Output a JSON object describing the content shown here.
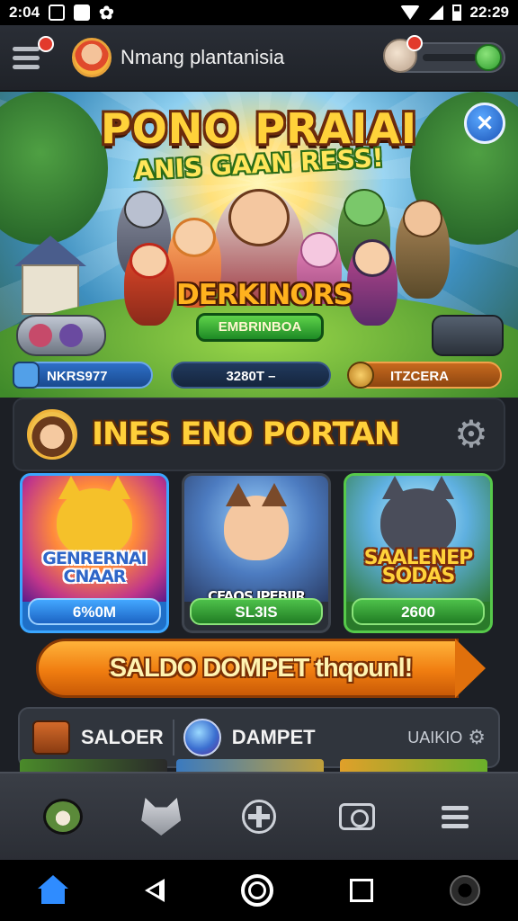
{
  "status_bar": {
    "time_left": "2:04",
    "time_right": "22:29"
  },
  "header": {
    "user_name": "Nmang plantanisia"
  },
  "banner": {
    "title": "PONO PRAIAI",
    "subtitle": "ANIS GAAN RESS!",
    "logo_text": "DERKINORS",
    "logo_plate": "EMBRINBOA",
    "stats": [
      "NKRS977",
      "3280T –",
      "ITZCERA"
    ]
  },
  "section": {
    "title": "INES ENO PORTAN"
  },
  "cards": [
    {
      "art_title": "GENRERNAI CNAAR",
      "price": "6%0M"
    },
    {
      "art_title": "CFAOS IPEBIIR",
      "price": "SL3IS"
    },
    {
      "art_title": "SAALENEP SODAS",
      "price": "2600"
    }
  ],
  "cta": {
    "label": "SALDO DOMPET thqounl!"
  },
  "wallet": {
    "left_label": "SALOER",
    "right_label": "DAMPET",
    "extra": "UAIKIO"
  },
  "colors": {
    "accent_orange": "#f07d10",
    "accent_yellow": "#ffcf3a",
    "accent_blue": "#2f8cff",
    "accent_green": "#4dc04a"
  },
  "icons": {
    "menu": "menu-icon",
    "share": "share-icon",
    "settings": "gear-icon",
    "home": "home-icon"
  }
}
